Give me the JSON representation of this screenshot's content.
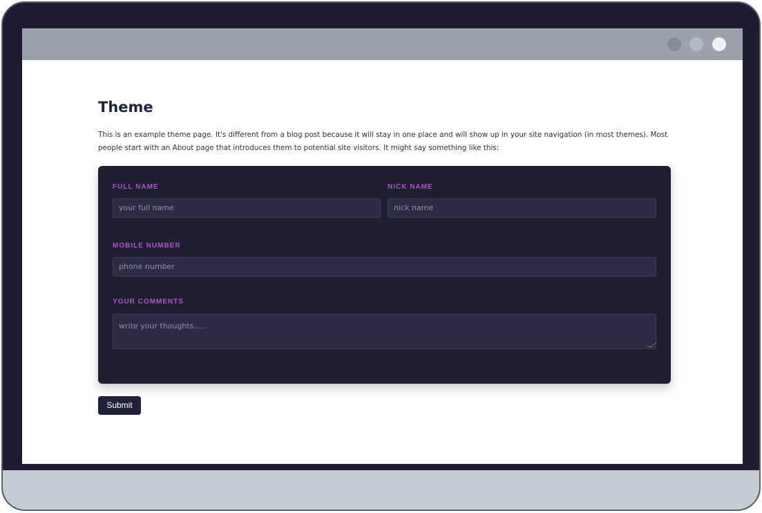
{
  "page": {
    "title": "Theme",
    "intro": "This is an example theme page. It's different from a blog post because it will stay in one place and will show up in your site navigation (in most themes). Most people start with an About page that introduces them to potential site visitors. It might say something like this:"
  },
  "form": {
    "full_name": {
      "label": "FULL NAME",
      "placeholder": "your full name"
    },
    "nick_name": {
      "label": "NICK NAME",
      "placeholder": "nick name"
    },
    "mobile": {
      "label": "MOBILE NUMBER",
      "placeholder": "phone number"
    },
    "comments": {
      "label": "YOUR COMMENTS",
      "placeholder": "write your thoughts....."
    },
    "submit_label": "Submit"
  },
  "colors": {
    "frame": "#1d1c30",
    "titlebar": "#9aa1ab",
    "card": "#201f31",
    "accent": "#a957c4",
    "field": "#2d2c44"
  }
}
